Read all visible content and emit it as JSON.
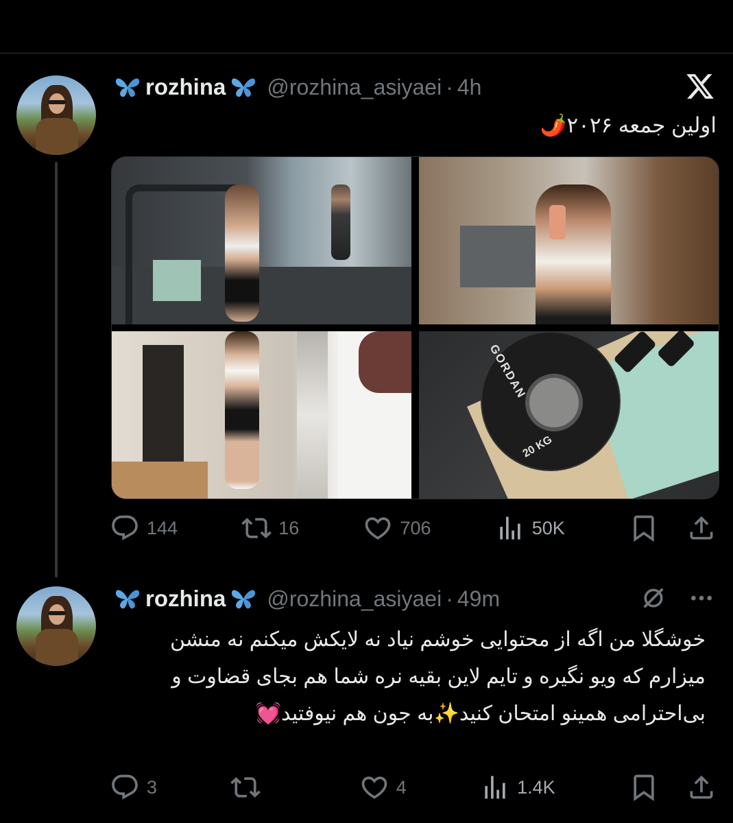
{
  "tweets": [
    {
      "name": "rozhina",
      "handle": "@rozhina_asiyaei",
      "time": "4h",
      "text": "اولین جمعه ۲۰۲۶🌶️",
      "replies": "144",
      "retweets": "16",
      "likes": "706",
      "views": "50K"
    },
    {
      "name": "rozhina",
      "handle": "@rozhina_asiyaei",
      "time": "49m",
      "text": "خوشگلا من اگه از محتوایی خوشم نیاد نه لایکش میکنم نه منشن میزارم که ویو نگیره و تایم لاین بقیه نره شما هم بجای قضاوت و بی‌احترامی همینو امتحان کنید✨به جون هم نیوفتید💓",
      "replies": "3",
      "retweets": "",
      "likes": "4",
      "views": "1.4K"
    }
  ],
  "icons": [
    "butterfly-icon",
    "x-logo-icon",
    "reply-icon",
    "retweet-icon",
    "like-icon",
    "views-icon",
    "bookmark-icon",
    "share-icon",
    "grok-icon",
    "more-icon"
  ],
  "colors": {
    "background": "#000000",
    "text": "#e7e9ea",
    "muted": "#71767b",
    "butterfly": "#5aa9e6",
    "divider": "#2f3336"
  },
  "media": {
    "images": [
      "gym-mirror-selfie-treadmill",
      "mirror-selfie-locker-room",
      "full-body-mirror-selfie",
      "weight-plate-dumbbells"
    ],
    "plate_text": "GORDAN",
    "plate_weight": "20 KG"
  }
}
